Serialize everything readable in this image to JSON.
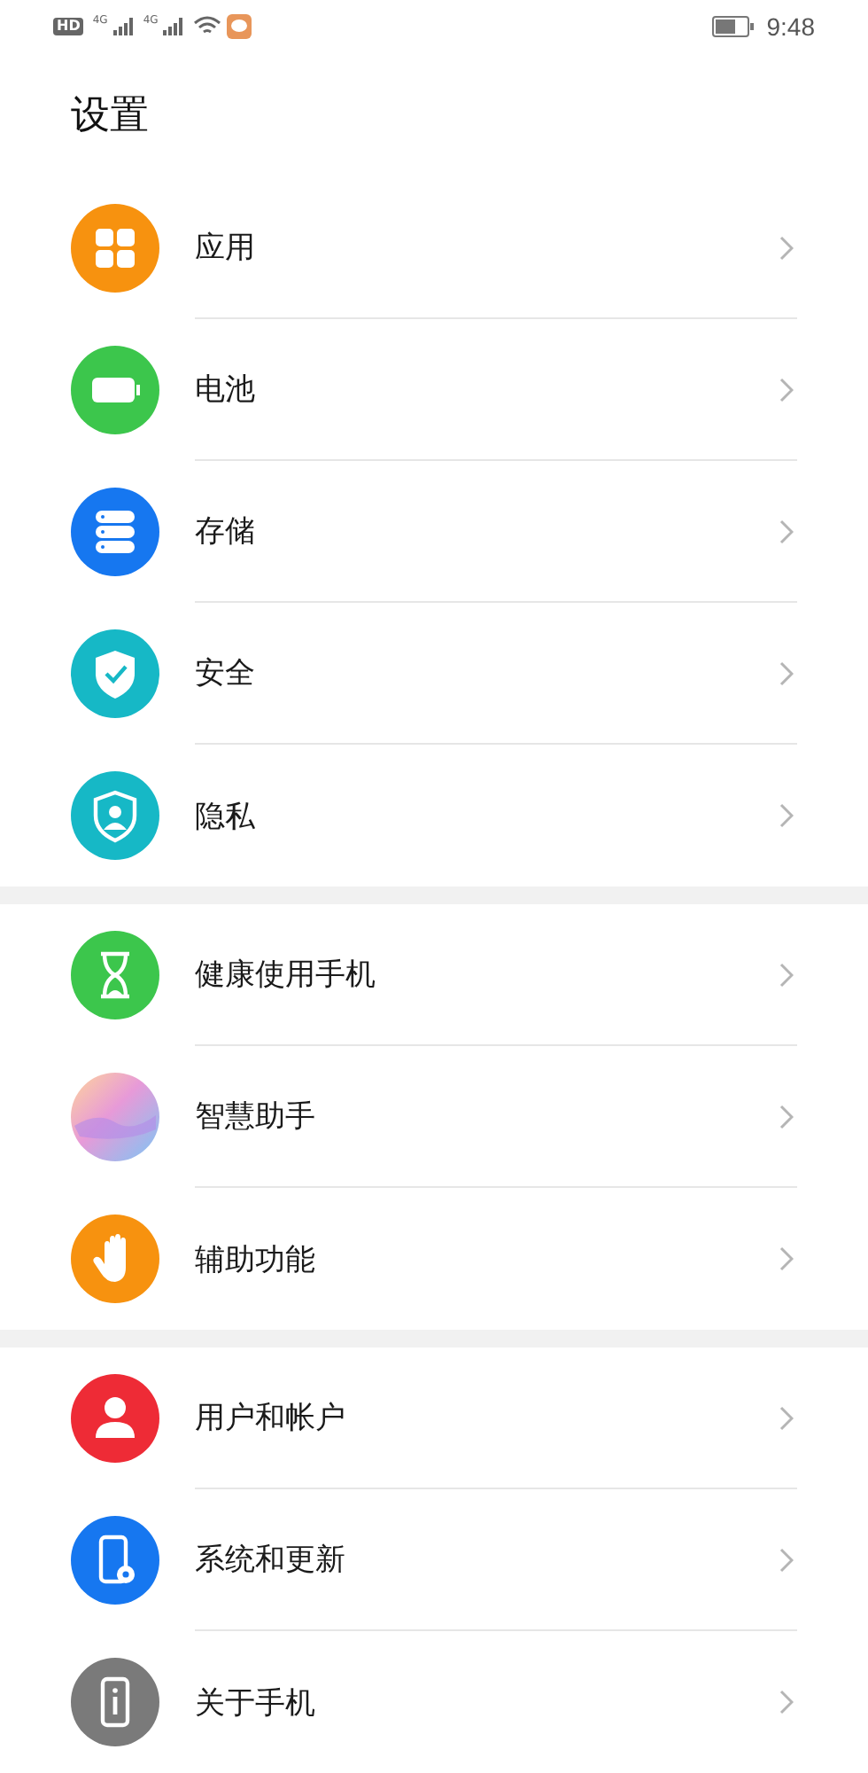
{
  "status_bar": {
    "hd_badge": "HD",
    "signals": [
      {
        "label": "4G"
      },
      {
        "label": "4G"
      }
    ],
    "time": "9:48"
  },
  "title": "设置",
  "groups": [
    {
      "items": [
        {
          "label": "应用",
          "kind": "apps",
          "color": "#f7920f"
        },
        {
          "label": "电池",
          "kind": "battery",
          "color": "#3cc64c"
        },
        {
          "label": "存储",
          "kind": "storage",
          "color": "#1677f0"
        },
        {
          "label": "安全",
          "kind": "security",
          "color": "#16b8c6"
        },
        {
          "label": "隐私",
          "kind": "privacy",
          "color": "#16b8c6"
        }
      ]
    },
    {
      "items": [
        {
          "label": "健康使用手机",
          "kind": "hourglass",
          "color": "#3cc64c"
        },
        {
          "label": "智慧助手",
          "kind": "assistant",
          "color": "#e79ad8"
        },
        {
          "label": "辅助功能",
          "kind": "hand",
          "color": "#f7920f"
        }
      ]
    },
    {
      "items": [
        {
          "label": "用户和帐户",
          "kind": "user",
          "color": "#ee2b36"
        },
        {
          "label": "系统和更新",
          "kind": "device",
          "color": "#1677f0"
        },
        {
          "label": "关于手机",
          "kind": "info",
          "color": "#7a7a7a"
        }
      ]
    }
  ]
}
